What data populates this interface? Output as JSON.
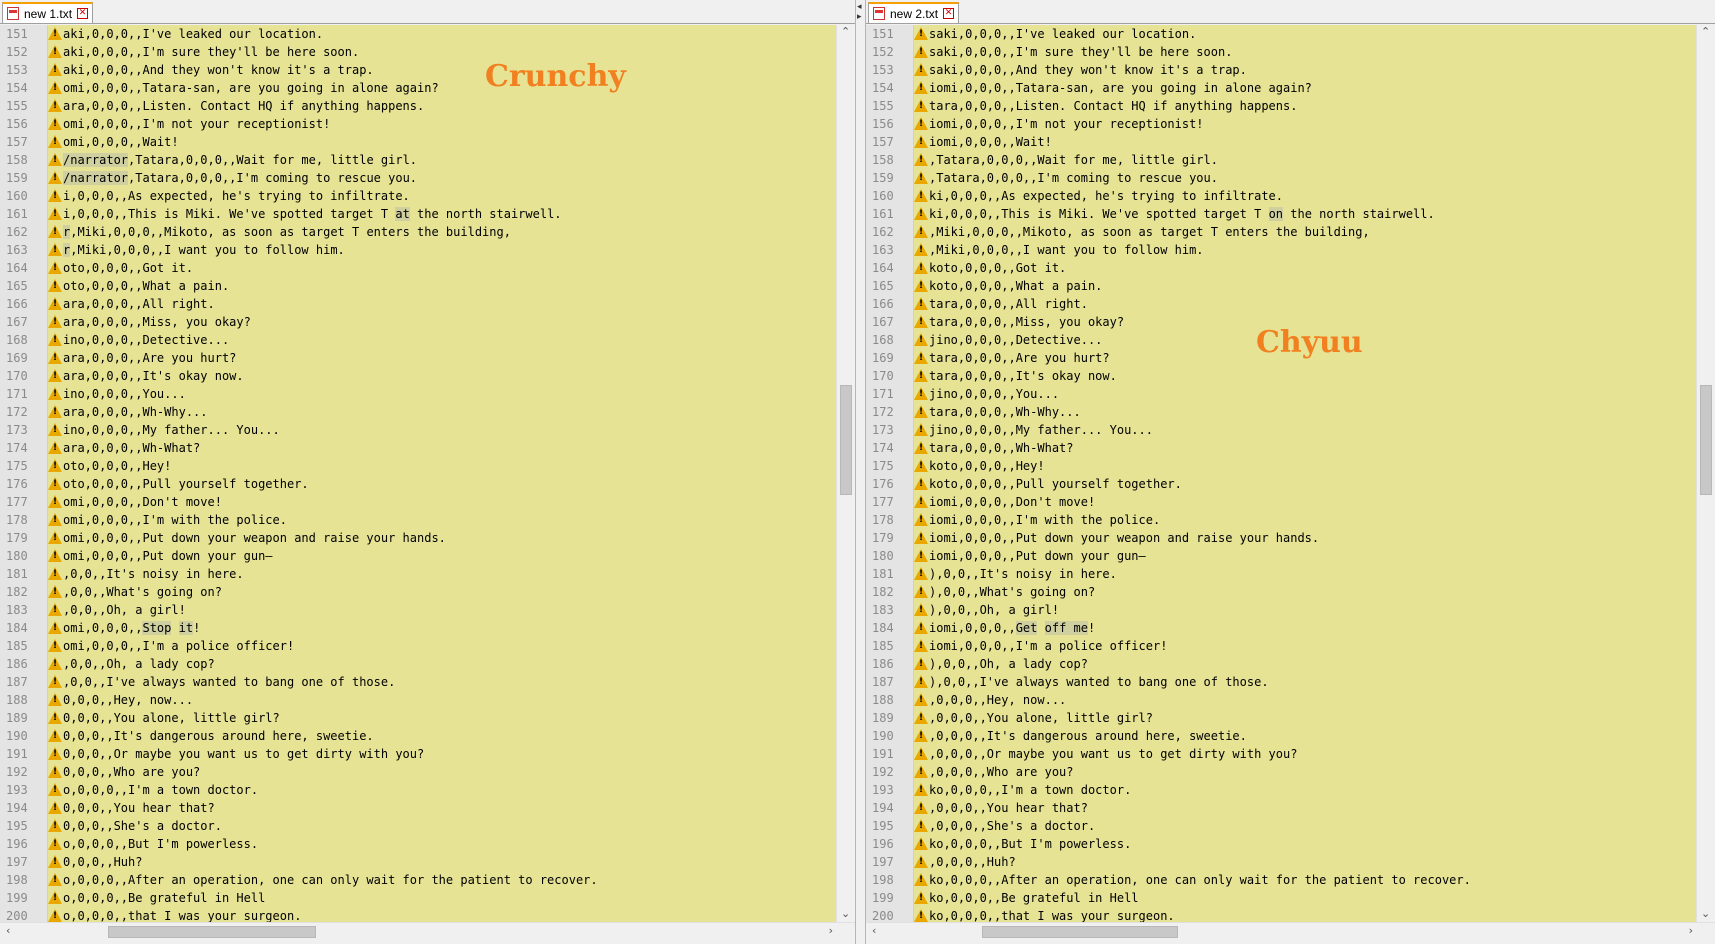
{
  "left": {
    "tab_title": "new  1.txt",
    "overlay_label": "Crunchy",
    "lines": [
      {
        "n": "151",
        "w": true,
        "parts": [
          {
            "t": "aki,0,0,0,,I've leaked our location."
          }
        ]
      },
      {
        "n": "152",
        "w": true,
        "parts": [
          {
            "t": "aki,0,0,0,,I'm sure they'll be here soon."
          }
        ]
      },
      {
        "n": "153",
        "w": true,
        "parts": [
          {
            "t": "aki,0,0,0,,And they won't know it's a trap."
          }
        ]
      },
      {
        "n": "154",
        "w": true,
        "parts": [
          {
            "t": "omi,0,0,0,,Tatara-san, are you going in alone again?"
          }
        ]
      },
      {
        "n": "155",
        "w": true,
        "parts": [
          {
            "t": "ara,0,0,0,,Listen. Contact HQ if anything happens."
          }
        ]
      },
      {
        "n": "156",
        "w": true,
        "parts": [
          {
            "t": "omi,0,0,0,,I'm not your receptionist!"
          }
        ]
      },
      {
        "n": "157",
        "w": true,
        "parts": [
          {
            "t": "omi,0,0,0,,Wait!"
          }
        ]
      },
      {
        "n": "158",
        "w": true,
        "parts": [
          {
            "t": "/narrator",
            "h": true
          },
          {
            "t": ",Tatara,0,0,0,,Wait for me, little girl."
          }
        ]
      },
      {
        "n": "159",
        "w": true,
        "parts": [
          {
            "t": "/narrator",
            "h": true
          },
          {
            "t": ",Tatara,0,0,0,,I'm coming to rescue you."
          }
        ]
      },
      {
        "n": "160",
        "w": true,
        "parts": [
          {
            "t": "i,0,0,0,,As expected, he's trying to infiltrate."
          }
        ]
      },
      {
        "n": "161",
        "w": true,
        "parts": [
          {
            "t": "i,0,0,0,,This is Miki. We've spotted target T "
          },
          {
            "t": "at",
            "h": true
          },
          {
            "t": " the north stairwell."
          }
        ]
      },
      {
        "n": "162",
        "w": true,
        "parts": [
          {
            "t": "r",
            "h": true
          },
          {
            "t": ",Miki,0,0,0,,Mikoto, as soon as target T enters the building,"
          }
        ]
      },
      {
        "n": "163",
        "w": true,
        "parts": [
          {
            "t": "r",
            "h": true
          },
          {
            "t": ",Miki,0,0,0,,I want you to follow him."
          }
        ]
      },
      {
        "n": "164",
        "w": true,
        "parts": [
          {
            "t": "oto,0,0,0,,Got it."
          }
        ]
      },
      {
        "n": "165",
        "w": true,
        "parts": [
          {
            "t": "oto,0,0,0,,What a pain."
          }
        ]
      },
      {
        "n": "166",
        "w": true,
        "parts": [
          {
            "t": "ara,0,0,0,,All right."
          }
        ]
      },
      {
        "n": "167",
        "w": true,
        "parts": [
          {
            "t": "ara,0,0,0,,Miss, you okay?"
          }
        ]
      },
      {
        "n": "168",
        "w": true,
        "parts": [
          {
            "t": "ino,0,0,0,,Detective..."
          }
        ]
      },
      {
        "n": "169",
        "w": true,
        "parts": [
          {
            "t": "ara,0,0,0,,Are you hurt?"
          }
        ]
      },
      {
        "n": "170",
        "w": true,
        "parts": [
          {
            "t": "ara,0,0,0,,It's okay now."
          }
        ]
      },
      {
        "n": "171",
        "w": true,
        "parts": [
          {
            "t": "ino,0,0,0,,You..."
          }
        ]
      },
      {
        "n": "172",
        "w": true,
        "parts": [
          {
            "t": "ara,0,0,0,,Wh-Why..."
          }
        ]
      },
      {
        "n": "173",
        "w": true,
        "parts": [
          {
            "t": "ino,0,0,0,,My father... You..."
          }
        ]
      },
      {
        "n": "174",
        "w": true,
        "parts": [
          {
            "t": "ara,0,0,0,,Wh-What?"
          }
        ]
      },
      {
        "n": "175",
        "w": true,
        "parts": [
          {
            "t": "oto,0,0,0,,Hey!"
          }
        ]
      },
      {
        "n": "176",
        "w": true,
        "parts": [
          {
            "t": "oto,0,0,0,,Pull yourself together."
          }
        ]
      },
      {
        "n": "177",
        "w": true,
        "parts": [
          {
            "t": "omi,0,0,0,,Don't move!"
          }
        ]
      },
      {
        "n": "178",
        "w": true,
        "parts": [
          {
            "t": "omi,0,0,0,,I'm with the police."
          }
        ]
      },
      {
        "n": "179",
        "w": true,
        "parts": [
          {
            "t": "omi,0,0,0,,Put down your weapon and raise your hands."
          }
        ]
      },
      {
        "n": "180",
        "w": true,
        "parts": [
          {
            "t": "omi,0,0,0,,Put down your gun—"
          }
        ]
      },
      {
        "n": "181",
        "w": true,
        "parts": [
          {
            "t": ",0,0,,It's noisy in here."
          }
        ]
      },
      {
        "n": "182",
        "w": true,
        "parts": [
          {
            "t": ",0,0,,What's going on?"
          }
        ]
      },
      {
        "n": "183",
        "w": true,
        "parts": [
          {
            "t": ",0,0,,Oh, a girl!"
          }
        ]
      },
      {
        "n": "184",
        "w": true,
        "parts": [
          {
            "t": "omi,0,0,0,,"
          },
          {
            "t": "Stop",
            "h": true
          },
          {
            "t": " "
          },
          {
            "t": "it",
            "h": true
          },
          {
            "t": "!"
          }
        ]
      },
      {
        "n": "185",
        "w": true,
        "parts": [
          {
            "t": "omi,0,0,0,,I'm a police officer!"
          }
        ]
      },
      {
        "n": "186",
        "w": true,
        "parts": [
          {
            "t": ",0,0,,Oh, a lady cop?"
          }
        ]
      },
      {
        "n": "187",
        "w": true,
        "parts": [
          {
            "t": ",0,0,,I've always wanted to bang one of those."
          }
        ]
      },
      {
        "n": "188",
        "w": true,
        "parts": [
          {
            "t": "0,0,0,,Hey, now..."
          }
        ]
      },
      {
        "n": "189",
        "w": true,
        "parts": [
          {
            "t": "0,0,0,,You alone, little girl?"
          }
        ]
      },
      {
        "n": "190",
        "w": true,
        "parts": [
          {
            "t": "0,0,0,,It's dangerous around here, sweetie."
          }
        ]
      },
      {
        "n": "191",
        "w": true,
        "parts": [
          {
            "t": "0,0,0,,Or maybe you want us to get dirty with you?"
          }
        ]
      },
      {
        "n": "192",
        "w": true,
        "parts": [
          {
            "t": "0,0,0,,Who are you?"
          }
        ]
      },
      {
        "n": "193",
        "w": true,
        "parts": [
          {
            "t": "o,0,0,0,,I'm a town doctor."
          }
        ]
      },
      {
        "n": "194",
        "w": true,
        "parts": [
          {
            "t": "0,0,0,,You hear that?"
          }
        ]
      },
      {
        "n": "195",
        "w": true,
        "parts": [
          {
            "t": "0,0,0,,She's a doctor."
          }
        ]
      },
      {
        "n": "196",
        "w": true,
        "parts": [
          {
            "t": "o,0,0,0,,But I'm powerless."
          }
        ]
      },
      {
        "n": "197",
        "w": true,
        "parts": [
          {
            "t": "0,0,0,,Huh?"
          }
        ]
      },
      {
        "n": "198",
        "w": true,
        "parts": [
          {
            "t": "o,0,0,0,,After an operation, one can only wait for the patient to recover."
          }
        ]
      },
      {
        "n": "199",
        "w": true,
        "parts": [
          {
            "t": "o,0,0,0,,Be grateful in Hell"
          }
        ]
      },
      {
        "n": "200",
        "w": true,
        "parts": [
          {
            "t": "o,0,0,0,,that I was your surgeon."
          }
        ]
      }
    ]
  },
  "right": {
    "tab_title": "new  2.txt",
    "overlay_label": "Chyuu",
    "lines": [
      {
        "n": "151",
        "w": true,
        "parts": [
          {
            "t": "saki,0,0,0,,I've leaked our location."
          }
        ]
      },
      {
        "n": "152",
        "w": true,
        "parts": [
          {
            "t": "saki,0,0,0,,I'm sure they'll be here soon."
          }
        ]
      },
      {
        "n": "153",
        "w": true,
        "parts": [
          {
            "t": "saki,0,0,0,,And they won't know it's a trap."
          }
        ]
      },
      {
        "n": "154",
        "w": true,
        "parts": [
          {
            "t": "iomi,0,0,0,,Tatara-san, are you going in alone again?"
          }
        ]
      },
      {
        "n": "155",
        "w": true,
        "parts": [
          {
            "t": "tara,0,0,0,,Listen. Contact HQ if anything happens."
          }
        ]
      },
      {
        "n": "156",
        "w": true,
        "parts": [
          {
            "t": "iomi,0,0,0,,I'm not your receptionist!"
          }
        ]
      },
      {
        "n": "157",
        "w": true,
        "parts": [
          {
            "t": "iomi,0,0,0,,Wait!"
          }
        ]
      },
      {
        "n": "158",
        "w": true,
        "parts": [
          {
            "t": ",Tatara,0,0,0,,Wait for me, little girl."
          }
        ]
      },
      {
        "n": "159",
        "w": true,
        "parts": [
          {
            "t": ",Tatara,0,0,0,,I'm coming to rescue you."
          }
        ]
      },
      {
        "n": "160",
        "w": true,
        "parts": [
          {
            "t": "ki,0,0,0,,As expected, he's trying to infiltrate."
          }
        ]
      },
      {
        "n": "161",
        "w": true,
        "parts": [
          {
            "t": "ki,0,0,0,,This is Miki. We've spotted target T "
          },
          {
            "t": "on",
            "h": true
          },
          {
            "t": " the north stairwell."
          }
        ]
      },
      {
        "n": "162",
        "w": true,
        "parts": [
          {
            "t": ",Miki,0,0,0,,Mikoto, as soon as target T enters the building,"
          }
        ]
      },
      {
        "n": "163",
        "w": true,
        "parts": [
          {
            "t": ",Miki,0,0,0,,I want you to follow him."
          }
        ]
      },
      {
        "n": "164",
        "w": true,
        "parts": [
          {
            "t": "koto,0,0,0,,Got it."
          }
        ]
      },
      {
        "n": "165",
        "w": true,
        "parts": [
          {
            "t": "koto,0,0,0,,What a pain."
          }
        ]
      },
      {
        "n": "166",
        "w": true,
        "parts": [
          {
            "t": "tara,0,0,0,,All right."
          }
        ]
      },
      {
        "n": "167",
        "w": true,
        "parts": [
          {
            "t": "tara,0,0,0,,Miss, you okay?"
          }
        ]
      },
      {
        "n": "168",
        "w": true,
        "parts": [
          {
            "t": "jino,0,0,0,,Detective..."
          }
        ]
      },
      {
        "n": "169",
        "w": true,
        "parts": [
          {
            "t": "tara,0,0,0,,Are you hurt?"
          }
        ]
      },
      {
        "n": "170",
        "w": true,
        "parts": [
          {
            "t": "tara,0,0,0,,It's okay now."
          }
        ]
      },
      {
        "n": "171",
        "w": true,
        "parts": [
          {
            "t": "jino,0,0,0,,You..."
          }
        ]
      },
      {
        "n": "172",
        "w": true,
        "parts": [
          {
            "t": "tara,0,0,0,,Wh-Why..."
          }
        ]
      },
      {
        "n": "173",
        "w": true,
        "parts": [
          {
            "t": "jino,0,0,0,,My father... You..."
          }
        ]
      },
      {
        "n": "174",
        "w": true,
        "parts": [
          {
            "t": "tara,0,0,0,,Wh-What?"
          }
        ]
      },
      {
        "n": "175",
        "w": true,
        "parts": [
          {
            "t": "koto,0,0,0,,Hey!"
          }
        ]
      },
      {
        "n": "176",
        "w": true,
        "parts": [
          {
            "t": "koto,0,0,0,,Pull yourself together."
          }
        ]
      },
      {
        "n": "177",
        "w": true,
        "parts": [
          {
            "t": "iomi,0,0,0,,Don't move!"
          }
        ]
      },
      {
        "n": "178",
        "w": true,
        "parts": [
          {
            "t": "iomi,0,0,0,,I'm with the police."
          }
        ]
      },
      {
        "n": "179",
        "w": true,
        "parts": [
          {
            "t": "iomi,0,0,0,,Put down your weapon and raise your hands."
          }
        ]
      },
      {
        "n": "180",
        "w": true,
        "parts": [
          {
            "t": "iomi,0,0,0,,Put down your gun—"
          }
        ]
      },
      {
        "n": "181",
        "w": true,
        "parts": [
          {
            "t": "),0,0,,It's noisy in here."
          }
        ]
      },
      {
        "n": "182",
        "w": true,
        "parts": [
          {
            "t": "),0,0,,What's going on?"
          }
        ]
      },
      {
        "n": "183",
        "w": true,
        "parts": [
          {
            "t": "),0,0,,Oh, a girl!"
          }
        ]
      },
      {
        "n": "184",
        "w": true,
        "parts": [
          {
            "t": "iomi,0,0,0,,"
          },
          {
            "t": "Get",
            "h": true
          },
          {
            "t": " "
          },
          {
            "t": "off me",
            "h": true
          },
          {
            "t": "!"
          }
        ]
      },
      {
        "n": "185",
        "w": true,
        "parts": [
          {
            "t": "iomi,0,0,0,,I'm a police officer!"
          }
        ]
      },
      {
        "n": "186",
        "w": true,
        "parts": [
          {
            "t": "),0,0,,Oh, a lady cop?"
          }
        ]
      },
      {
        "n": "187",
        "w": true,
        "parts": [
          {
            "t": "),0,0,,I've always wanted to bang one of those."
          }
        ]
      },
      {
        "n": "188",
        "w": true,
        "parts": [
          {
            "t": ",0,0,0,,Hey, now..."
          }
        ]
      },
      {
        "n": "189",
        "w": true,
        "parts": [
          {
            "t": ",0,0,0,,You alone, little girl?"
          }
        ]
      },
      {
        "n": "190",
        "w": true,
        "parts": [
          {
            "t": ",0,0,0,,It's dangerous around here, sweetie."
          }
        ]
      },
      {
        "n": "191",
        "w": true,
        "parts": [
          {
            "t": ",0,0,0,,Or maybe you want us to get dirty with you?"
          }
        ]
      },
      {
        "n": "192",
        "w": true,
        "parts": [
          {
            "t": ",0,0,0,,Who are you?"
          }
        ]
      },
      {
        "n": "193",
        "w": true,
        "parts": [
          {
            "t": "ko,0,0,0,,I'm a town doctor."
          }
        ]
      },
      {
        "n": "194",
        "w": true,
        "parts": [
          {
            "t": ",0,0,0,,You hear that?"
          }
        ]
      },
      {
        "n": "195",
        "w": true,
        "parts": [
          {
            "t": ",0,0,0,,She's a doctor."
          }
        ]
      },
      {
        "n": "196",
        "w": true,
        "parts": [
          {
            "t": "ko,0,0,0,,But I'm powerless."
          }
        ]
      },
      {
        "n": "197",
        "w": true,
        "parts": [
          {
            "t": ",0,0,0,,Huh?"
          }
        ]
      },
      {
        "n": "198",
        "w": true,
        "parts": [
          {
            "t": "ko,0,0,0,,After an operation, one can only wait for the patient to recover."
          }
        ]
      },
      {
        "n": "199",
        "w": true,
        "parts": [
          {
            "t": "ko,0,0,0,,Be grateful in Hell"
          }
        ]
      },
      {
        "n": "200",
        "w": true,
        "parts": [
          {
            "t": "ko,0,0,0,,that I was your surgeon."
          }
        ]
      }
    ]
  },
  "colors": {
    "editor_bg": "#e6e395",
    "highlight": "#cfcf9f",
    "overlay_text": "#f08020",
    "tab_accent": "#f5a000",
    "warning": "#e8a800"
  },
  "icons": {
    "tab_file": "notepad-file-icon",
    "tab_close": "close-icon",
    "line_marker": "warning-icon"
  }
}
